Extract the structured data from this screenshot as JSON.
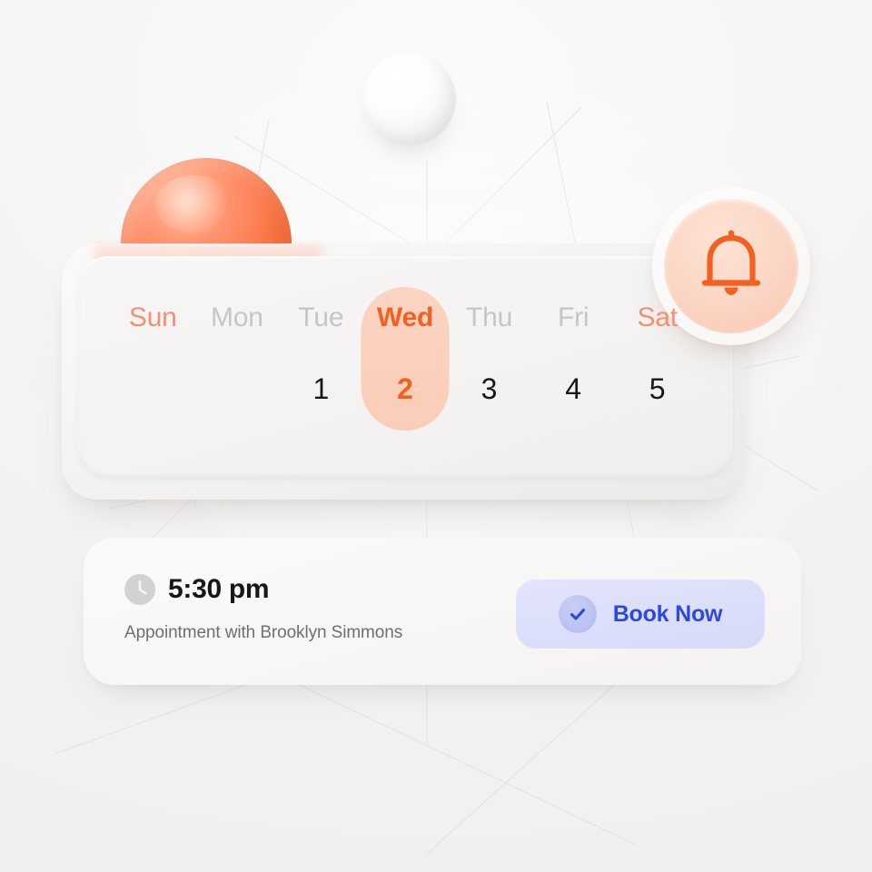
{
  "scene": {
    "background_color": "#f5f4f3",
    "decor": {
      "white_sphere": "white-sphere",
      "orange_sphere": "orange-sphere",
      "grid_lines": "background-grid-lines"
    }
  },
  "calendar": {
    "selected_day": "Wed",
    "selected_date": "2",
    "accent_color": "#f4601f",
    "weekend_color": "#f29070",
    "weekday_color": "#c6c5c7",
    "selection_pill_color": "#fbd0bc",
    "days": [
      {
        "name": "Sun",
        "date": "",
        "kind": "weekend",
        "selected": false
      },
      {
        "name": "Mon",
        "date": "",
        "kind": "weekday",
        "selected": false
      },
      {
        "name": "Tue",
        "date": "1",
        "kind": "weekday",
        "selected": false
      },
      {
        "name": "Wed",
        "date": "2",
        "kind": "weekday",
        "selected": true
      },
      {
        "name": "Thu",
        "date": "3",
        "kind": "weekday",
        "selected": false
      },
      {
        "name": "Fri",
        "date": "4",
        "kind": "weekday",
        "selected": false
      },
      {
        "name": "Sat",
        "date": "5",
        "kind": "weekend",
        "selected": false
      }
    ]
  },
  "notification": {
    "icon": "bell-icon",
    "icon_color": "#f4601f",
    "badge_color": "#fbd5c3"
  },
  "appointment": {
    "clock_icon": "clock-icon",
    "time": "5:30 pm",
    "description": "Appointment with Brooklyn Simmons",
    "button": {
      "label": "Book Now",
      "icon": "check-circle-icon",
      "text_color": "#2c48e0",
      "background_color": "#dcdffa"
    }
  }
}
